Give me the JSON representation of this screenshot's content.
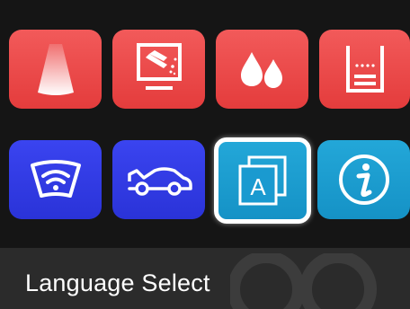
{
  "menu": {
    "tiles": [
      {
        "icon": "light-beam-icon",
        "color": "#e84545"
      },
      {
        "icon": "screen-cleaning-icon",
        "color": "#e84545"
      },
      {
        "icon": "water-drops-icon",
        "color": "#e84545"
      },
      {
        "icon": "fluid-level-icon",
        "color": "#e84545"
      },
      {
        "icon": "windshield-wifi-icon",
        "color": "#2f38e6"
      },
      {
        "icon": "car-icon",
        "color": "#2f38e6"
      },
      {
        "icon": "language-letter-a-icon",
        "color": "#1ea1d4"
      },
      {
        "icon": "info-icon",
        "color": "#1ea1d4"
      }
    ],
    "selected_tile": "language-letter-a-icon"
  },
  "footer": {
    "title": "Language Select"
  }
}
